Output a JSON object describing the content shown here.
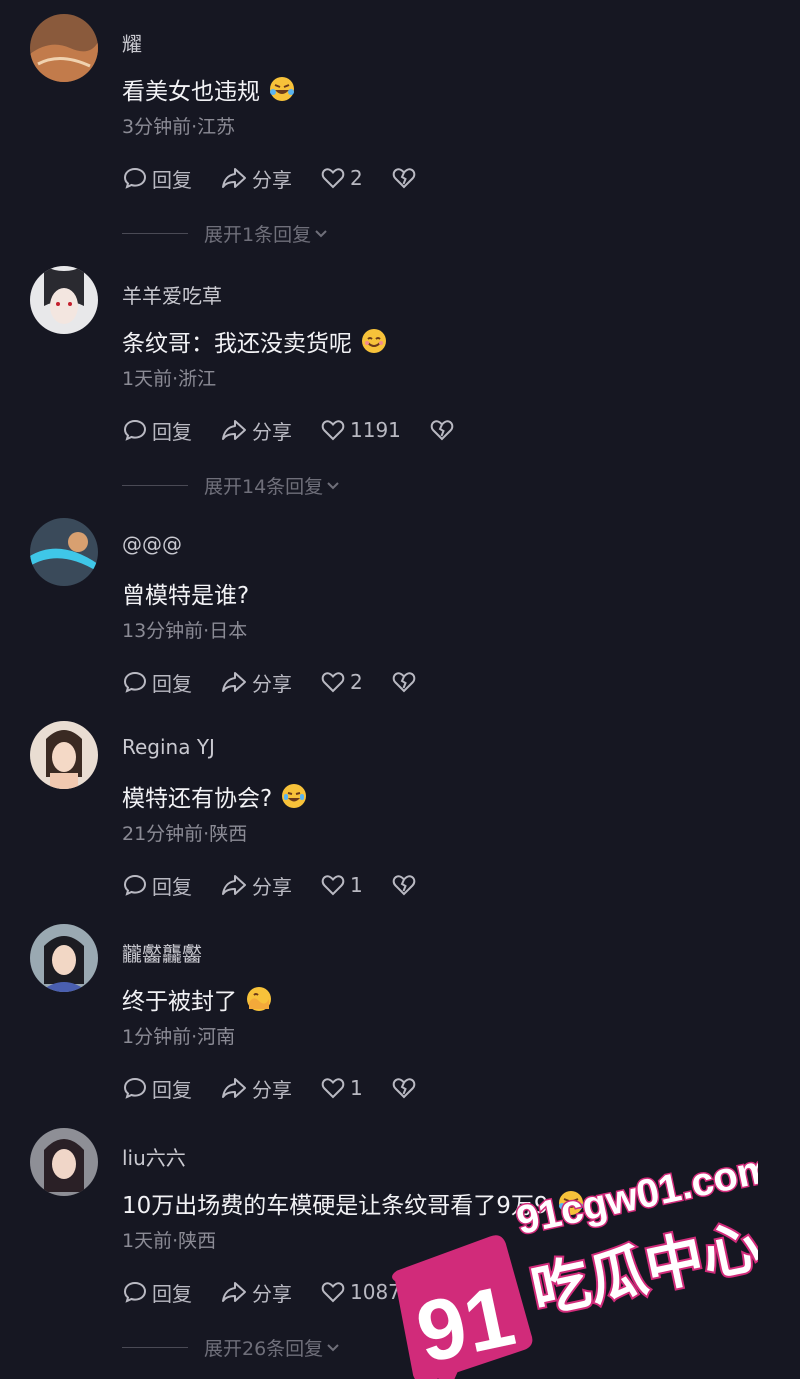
{
  "labels": {
    "reply": "回复",
    "share": "分享"
  },
  "comments": [
    {
      "username": "耀",
      "text": "看美女也违规",
      "emoji": "rofl",
      "meta": "3分钟前·江苏",
      "likes": "2",
      "expand": "展开1条回复"
    },
    {
      "username": "羊羊爱吃草",
      "text": "条纹哥：我还没卖货呢",
      "emoji": "smile",
      "meta": "1天前·浙江",
      "likes": "1191",
      "expand": "展开14条回复"
    },
    {
      "username": "@@@",
      "text": "曾模特是谁?",
      "emoji": "",
      "meta": "13分钟前·日本",
      "likes": "2",
      "expand": ""
    },
    {
      "username": "Regina YJ",
      "text": "模特还有协会?",
      "emoji": "tears",
      "meta": "21分钟前·陕西",
      "likes": "1",
      "expand": ""
    },
    {
      "username": "龖齾龘齾",
      "text": "终于被封了",
      "emoji": "hide",
      "meta": "1分钟前·河南",
      "likes": "1",
      "expand": ""
    },
    {
      "username": "liu六六",
      "text": "10万出场费的车模硬是让条纹哥看了9万9",
      "emoji": "rofl",
      "meta": "1天前·陕西",
      "likes": "1087",
      "expand": "展开26条回复"
    }
  ],
  "watermark": {
    "number": "91",
    "url": "91cgw01.com",
    "name": "吃瓜中心"
  },
  "colors": {
    "background": "#161722",
    "watermark_pink": "#d12b7a"
  }
}
